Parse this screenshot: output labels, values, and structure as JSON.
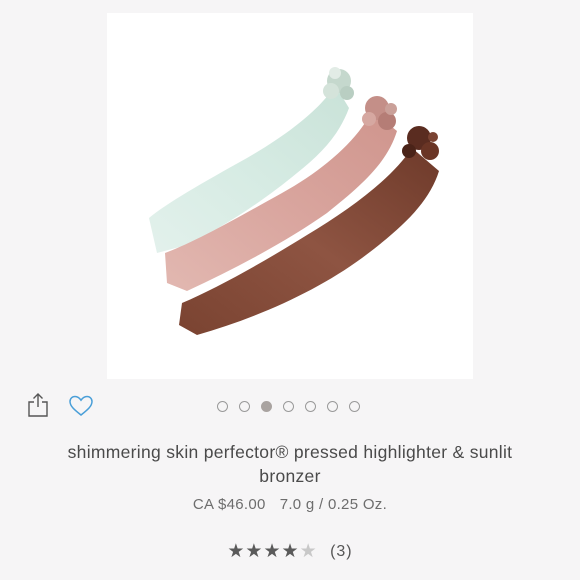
{
  "product": {
    "image_alt": "product swatch",
    "title": "shimmering skin perfector® pressed highlighter & sunlit bronzer",
    "price": "CA $46.00",
    "size": "7.0 g / 0.25 Oz."
  },
  "actions": {
    "share_icon": "share-icon",
    "favorite_icon": "heart-icon"
  },
  "carousel": {
    "count": 7,
    "active_index": 2
  },
  "rating": {
    "value": 4,
    "max": 5,
    "count_label": "(3)"
  },
  "colors": {
    "mint": "#dbeee6",
    "pink": "#dcaaa4",
    "bronze": "#8c5240",
    "text": "#4a4a4a",
    "accent_blue": "#4a9fd8"
  }
}
